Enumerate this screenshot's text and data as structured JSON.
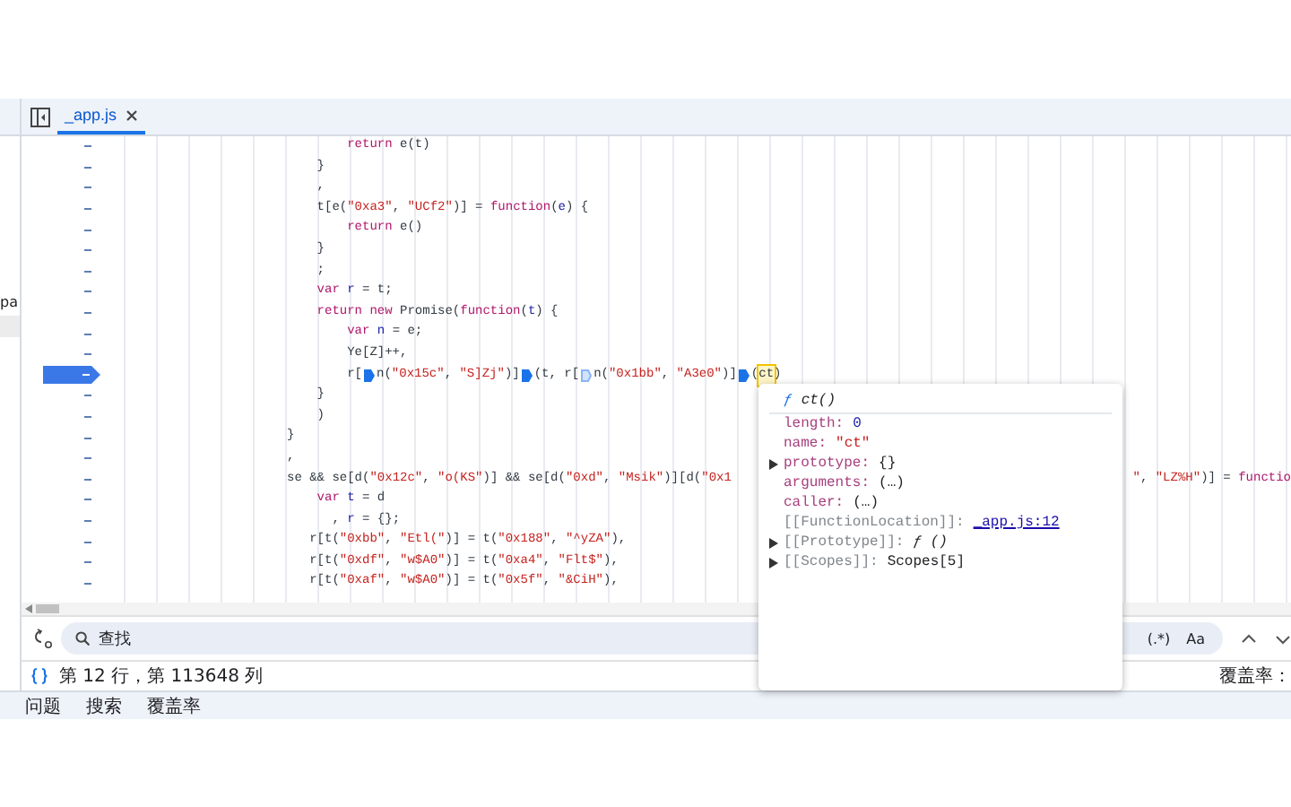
{
  "tabs": [
    {
      "label": "_app.js",
      "selected": true
    }
  ],
  "sidebar": {
    "items": [
      {
        "label": "pa"
      }
    ]
  },
  "code_lines": [
    {
      "breakpoint": false,
      "tokens": [
        {
          "kind": "keyword",
          "text": "        return"
        },
        {
          "kind": "plain",
          "text": " e(t)"
        }
      ]
    },
    {
      "breakpoint": false,
      "tokens": [
        {
          "kind": "plain",
          "text": "    }"
        }
      ]
    },
    {
      "breakpoint": false,
      "tokens": [
        {
          "kind": "plain",
          "text": "    ,"
        }
      ]
    },
    {
      "breakpoint": false,
      "tokens": [
        {
          "kind": "plain",
          "text": "    t[e("
        },
        {
          "kind": "string",
          "text": "\"0xa3\""
        },
        {
          "kind": "plain",
          "text": ", "
        },
        {
          "kind": "string",
          "text": "\"UCf2\""
        },
        {
          "kind": "plain",
          "text": ")] = "
        },
        {
          "kind": "keyword",
          "text": "function"
        },
        {
          "kind": "plain",
          "text": "("
        },
        {
          "kind": "name",
          "text": "e"
        },
        {
          "kind": "plain",
          "text": ") {"
        }
      ]
    },
    {
      "breakpoint": false,
      "tokens": [
        {
          "kind": "keyword",
          "text": "        return"
        },
        {
          "kind": "plain",
          "text": " e()"
        }
      ]
    },
    {
      "breakpoint": false,
      "tokens": [
        {
          "kind": "plain",
          "text": "    }"
        }
      ]
    },
    {
      "breakpoint": false,
      "tokens": [
        {
          "kind": "plain",
          "text": "    ;"
        }
      ]
    },
    {
      "breakpoint": false,
      "tokens": [
        {
          "kind": "keyword",
          "text": "    var"
        },
        {
          "kind": "name",
          "text": " r"
        },
        {
          "kind": "plain",
          "text": " = t;"
        }
      ]
    },
    {
      "breakpoint": false,
      "tokens": [
        {
          "kind": "keyword",
          "text": "    return new"
        },
        {
          "kind": "plain",
          "text": " Promise("
        },
        {
          "kind": "keyword",
          "text": "function"
        },
        {
          "kind": "plain",
          "text": "("
        },
        {
          "kind": "name",
          "text": "t"
        },
        {
          "kind": "plain",
          "text": ") {"
        }
      ]
    },
    {
      "breakpoint": false,
      "tokens": [
        {
          "kind": "keyword",
          "text": "        var"
        },
        {
          "kind": "name",
          "text": " n"
        },
        {
          "kind": "plain",
          "text": " = e;"
        }
      ]
    },
    {
      "breakpoint": false,
      "tokens": [
        {
          "kind": "plain",
          "text": "        Ye[Z]++,"
        }
      ]
    },
    {
      "breakpoint": true,
      "tokens": [
        {
          "kind": "plain",
          "text": "        r["
        },
        {
          "kind": "marker",
          "on": true
        },
        {
          "kind": "plain",
          "text": "n("
        },
        {
          "kind": "string",
          "text": "\"0x15c\""
        },
        {
          "kind": "plain",
          "text": ", "
        },
        {
          "kind": "string",
          "text": "\"S]Zj\""
        },
        {
          "kind": "plain",
          "text": ")]"
        },
        {
          "kind": "marker",
          "on": true
        },
        {
          "kind": "plain",
          "text": "(t, r["
        },
        {
          "kind": "marker",
          "on": false
        },
        {
          "kind": "plain",
          "text": "n("
        },
        {
          "kind": "string",
          "text": "\"0x1bb\""
        },
        {
          "kind": "plain",
          "text": ", "
        },
        {
          "kind": "string",
          "text": "\"A3e0\""
        },
        {
          "kind": "plain",
          "text": ")]"
        },
        {
          "kind": "marker",
          "on": true
        },
        {
          "kind": "plain",
          "text": "("
        },
        {
          "kind": "hover",
          "text": "ct"
        },
        {
          "kind": "plain",
          "text": ")"
        }
      ]
    },
    {
      "breakpoint": false,
      "tokens": [
        {
          "kind": "plain",
          "text": "    }"
        }
      ]
    },
    {
      "breakpoint": false,
      "tokens": [
        {
          "kind": "plain",
          "text": "    )"
        }
      ]
    },
    {
      "breakpoint": false,
      "tokens": [
        {
          "kind": "plain",
          "text": "}"
        }
      ]
    },
    {
      "breakpoint": false,
      "tokens": [
        {
          "kind": "plain",
          "text": ","
        }
      ]
    },
    {
      "breakpoint": false,
      "tokens": [
        {
          "kind": "plain",
          "text": "se && se[d("
        },
        {
          "kind": "string",
          "text": "\"0x12c\""
        },
        {
          "kind": "plain",
          "text": ", "
        },
        {
          "kind": "string",
          "text": "\"o(KS\""
        },
        {
          "kind": "plain",
          "text": ")] && se[d("
        },
        {
          "kind": "string",
          "text": "\"0xd\""
        },
        {
          "kind": "plain",
          "text": ", "
        },
        {
          "kind": "string",
          "text": "\"Msik\""
        },
        {
          "kind": "plain",
          "text": ")][d("
        },
        {
          "kind": "string",
          "text": "\"0x1"
        }
      ],
      "right_tokens": [
        {
          "kind": "string",
          "text": "\""
        },
        {
          "kind": "plain",
          "text": ", "
        },
        {
          "kind": "string",
          "text": "\"LZ%H\""
        },
        {
          "kind": "plain",
          "text": ")] = "
        },
        {
          "kind": "keyword",
          "text": "functio"
        }
      ]
    },
    {
      "breakpoint": false,
      "tokens": [
        {
          "kind": "keyword",
          "text": "    var"
        },
        {
          "kind": "name",
          "text": " t"
        },
        {
          "kind": "plain",
          "text": " = d"
        }
      ]
    },
    {
      "breakpoint": false,
      "tokens": [
        {
          "kind": "plain",
          "text": "      , "
        },
        {
          "kind": "name",
          "text": "r"
        },
        {
          "kind": "plain",
          "text": " = {};"
        }
      ]
    },
    {
      "breakpoint": false,
      "tokens": [
        {
          "kind": "plain",
          "text": "   r[t("
        },
        {
          "kind": "string",
          "text": "\"0xbb\""
        },
        {
          "kind": "plain",
          "text": ", "
        },
        {
          "kind": "string",
          "text": "\"Etl(\""
        },
        {
          "kind": "plain",
          "text": ")] = t("
        },
        {
          "kind": "string",
          "text": "\"0x188\""
        },
        {
          "kind": "plain",
          "text": ", "
        },
        {
          "kind": "string",
          "text": "\"^yZA\""
        },
        {
          "kind": "plain",
          "text": "),"
        }
      ]
    },
    {
      "breakpoint": false,
      "tokens": [
        {
          "kind": "plain",
          "text": "   r[t("
        },
        {
          "kind": "string",
          "text": "\"0xdf\""
        },
        {
          "kind": "plain",
          "text": ", "
        },
        {
          "kind": "string",
          "text": "\"w$A0\""
        },
        {
          "kind": "plain",
          "text": ")] = t("
        },
        {
          "kind": "string",
          "text": "\"0xa4\""
        },
        {
          "kind": "plain",
          "text": ", "
        },
        {
          "kind": "string",
          "text": "\"Flt$\""
        },
        {
          "kind": "plain",
          "text": "),"
        }
      ]
    },
    {
      "breakpoint": false,
      "tokens": [
        {
          "kind": "plain",
          "text": "   r[t("
        },
        {
          "kind": "string",
          "text": "\"0xaf\""
        },
        {
          "kind": "plain",
          "text": ", "
        },
        {
          "kind": "string",
          "text": "\"w$A0\""
        },
        {
          "kind": "plain",
          "text": ")] = t("
        },
        {
          "kind": "string",
          "text": "\"0x5f\""
        },
        {
          "kind": "plain",
          "text": ", "
        },
        {
          "kind": "string",
          "text": "\"&CiH\""
        },
        {
          "kind": "plain",
          "text": "),"
        }
      ]
    }
  ],
  "popover": {
    "glyph": "ƒ",
    "title": "ct()",
    "properties": [
      {
        "key": "length:",
        "value": "0",
        "kind": "number",
        "internal": false,
        "expandable": false
      },
      {
        "key": "name:",
        "value": "\"ct\"",
        "kind": "string",
        "internal": false,
        "expandable": false
      },
      {
        "key": "prototype:",
        "value": "{}",
        "kind": "object",
        "internal": false,
        "expandable": true
      },
      {
        "key": "arguments:",
        "value": "(…)",
        "kind": "object",
        "internal": false,
        "expandable": false
      },
      {
        "key": "caller:",
        "value": "(…)",
        "kind": "object",
        "internal": false,
        "expandable": false
      },
      {
        "key": "[[FunctionLocation]]:",
        "value": "_app.js:12",
        "kind": "link",
        "internal": true,
        "expandable": false
      },
      {
        "key": "[[Prototype]]:",
        "value": "ƒ ()",
        "kind": "function",
        "internal": true,
        "expandable": true
      },
      {
        "key": "[[Scopes]]:",
        "value": "Scopes[5]",
        "kind": "object",
        "internal": true,
        "expandable": true
      }
    ]
  },
  "search": {
    "placeholder": "查找",
    "options": [
      {
        "label": "(.*)"
      },
      {
        "label": "Aa"
      }
    ]
  },
  "status_bar": {
    "position": "第 12 行，第 113648 列",
    "coverage": "覆盖率："
  },
  "drawer_tabs": [
    {
      "label": "问题"
    },
    {
      "label": "搜索"
    },
    {
      "label": "覆盖率"
    }
  ]
}
